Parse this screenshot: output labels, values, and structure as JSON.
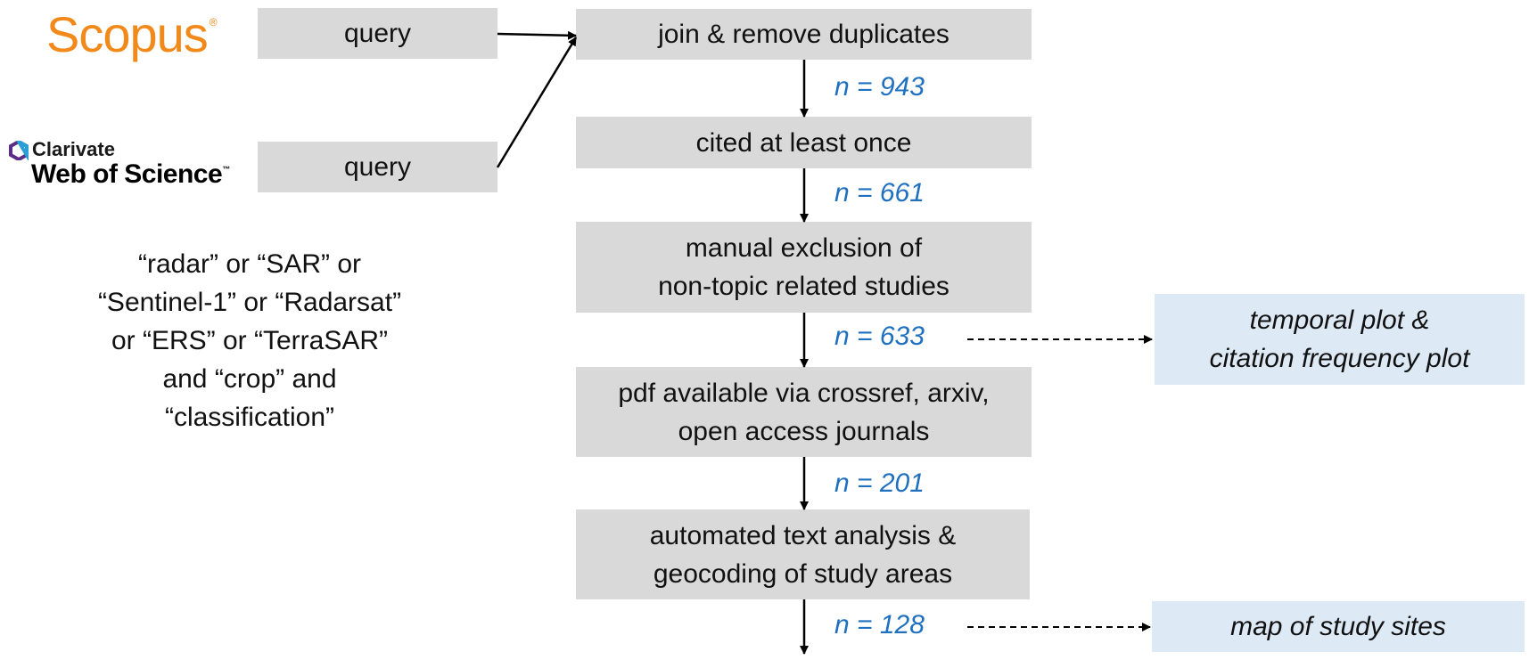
{
  "logos": {
    "scopus": "Scopus",
    "scopus_mark": "®",
    "clarivate": "Clarivate",
    "web_of_science": "Web of Science",
    "wos_mark": "™"
  },
  "queries": [
    "query",
    "query"
  ],
  "search_terms": [
    "“radar” or “SAR” or",
    "“Sentinel-1” or “Radarsat”",
    "or “ERS” or “TerraSAR”",
    "and “crop” and",
    "“classification”"
  ],
  "steps": [
    {
      "lines": [
        "join & remove duplicates"
      ]
    },
    {
      "lines": [
        "cited at least once"
      ]
    },
    {
      "lines": [
        "manual exclusion of",
        "non-topic related studies"
      ]
    },
    {
      "lines": [
        "pdf available via crossref, arxiv,",
        "open access journals"
      ]
    },
    {
      "lines": [
        "automated text analysis &",
        "geocoding of study areas"
      ]
    }
  ],
  "counts": [
    "n = 943",
    "n = 661",
    "n = 633",
    "n = 201",
    "n = 128"
  ],
  "outputs": [
    {
      "lines": [
        "temporal plot &",
        "citation frequency plot"
      ]
    },
    {
      "lines": [
        "map of study sites"
      ]
    }
  ],
  "colors": {
    "box": "#d9d9d9",
    "output_box": "#dee9f6",
    "count": "#1f70bf",
    "scopus": "#f28a1b"
  }
}
